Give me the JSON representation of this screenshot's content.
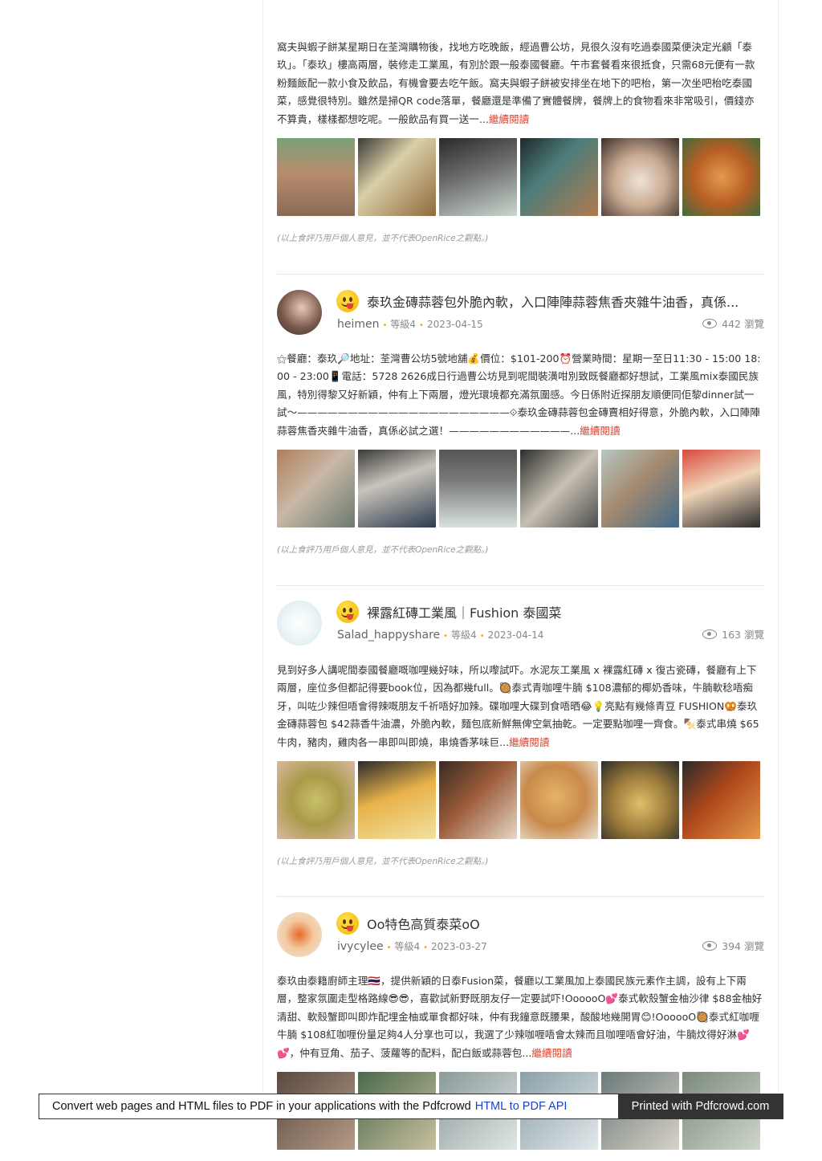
{
  "reviews": [
    {
      "body": "窩夫與蝦子餅某星期日在荃灣購物後，找地方吃晚飯，經過曹公坊，見很久沒有吃過泰國菜便決定光顧「泰玖」。「泰玖」樓高兩層，裝修走工業風，有別於跟一般泰國餐廳。午市套餐看來很抵食，只需68元便有一款粉麵飯配一款小食及飲品，有機會要去吃午飯。窩夫與蝦子餅被安排坐在地下的吧枱，第一次坐吧枱吃泰國菜，感覺很特別。雖然是掃QR code落單，餐廳還是準備了實體餐牌，餐牌上的食物看來非常吸引，價錢亦不算貴，樣樣都想吃呢。一般飲品有買一送一...",
      "more": "繼續閱讀",
      "disclaimer": "(以上食評乃用戶個人意見，並不代表OpenRice之觀點。)"
    },
    {
      "title": "泰玖金磚蒜蓉包外脆內軟，入口陣陣蒜蓉焦香夾雜牛油香，真係...",
      "user": "heimen",
      "level": "等級4",
      "date": "2023-04-15",
      "views": "442 瀏覽",
      "body": "⚝餐廳：泰玖🔎地址：荃灣曹公坊5號地舖💰價位：$101-200⏰營業時間：星期一至日11:30 - 15:00 18:00 - 23:00📱電話：5728 2626成日行過曹公坊見到呢間裝潢咁別致既餐廳都好想試，工業風mix泰國民族風，特別得黎又好新穎，仲有上下兩層，燈光環境都充滿氛圍感。今日係附近探朋友順便同佢黎dinner試一試〜—————————————————————⟐泰玖金磚蒜蓉包金磚賣相好得意，外脆內軟，入口陣陣蒜蓉焦香夾雜牛油香，真係必試之選！————————————...",
      "more": "繼續閱讀",
      "disclaimer": "(以上食評乃用戶個人意見，並不代表OpenRice之觀點。)"
    },
    {
      "title": "裸露紅磚工業風｜Fushion 泰國菜",
      "user": "Salad_happyshare",
      "level": "等級4",
      "date": "2023-04-14",
      "views": "163 瀏覽",
      "body": "見到好多人講呢間泰國餐廳嘅咖哩幾好味，所以嚟試吓。水泥灰工業風 x 裸露紅磚 x 復古瓷磚，餐廳有上下兩層，座位多但都記得要book位，因為都幾full。🥘泰式青咖哩牛腩 $108濃郁的椰奶香味，牛腩軟稔唔痴牙，叫咗少辣但唔會得辣嘅朋友千祈唔好加辣。碟咖哩大碟到食唔晒😂💡亮點有幾條青豆 FUSHION🥨泰玖金磚蒜蓉包 $42蒜香牛油濃，外脆內軟，麵包底新鮮無俾空氣抽乾。一定要點咖哩一齊食。🍢泰式串燒 $65牛肉，豬肉，雞肉各一串即叫即燒，串燒香茅味巨...",
      "more": "繼續閱讀",
      "disclaimer": "(以上食評乃用戶個人意見，並不代表OpenRice之觀點。)"
    },
    {
      "title": "Oo特色高質泰菜oO",
      "user": "ivycylee",
      "level": "等級4",
      "date": "2023-03-27",
      "views": "394 瀏覽",
      "body": "泰玖由泰籍廚師主理🇹🇭，提供新穎的日泰Fusion菜，餐廳以工業風加上泰國民族元素作主調，設有上下兩層，整家氛圍走型格路線😎😎，喜歡試新野既朋友仔一定要試吓!OooooO💕泰式軟殼蟹金柚沙律 $88金柚好清甜、軟殼蟹即叫即炸配埋金柚或單食都好味，仲有我鐘意既腰果，酸酸地幾開胃😊!OooooO🥘泰式紅咖喱牛腩 $108紅咖喱份量足夠4人分享也可以，我選了少辣咖喱唔會太辣而且咖哩唔會好油，牛腩炆得好淋💕💕，仲有豆角、茄子、菠蘿等的配料，配白飯或蒜蓉包...",
      "more": "繼續閱讀"
    }
  ],
  "footer": {
    "text": "Convert web pages and HTML files to PDF in your applications with the Pdfcrowd",
    "link": "HTML to PDF API",
    "printed": "Printed with Pdfcrowd.com"
  }
}
